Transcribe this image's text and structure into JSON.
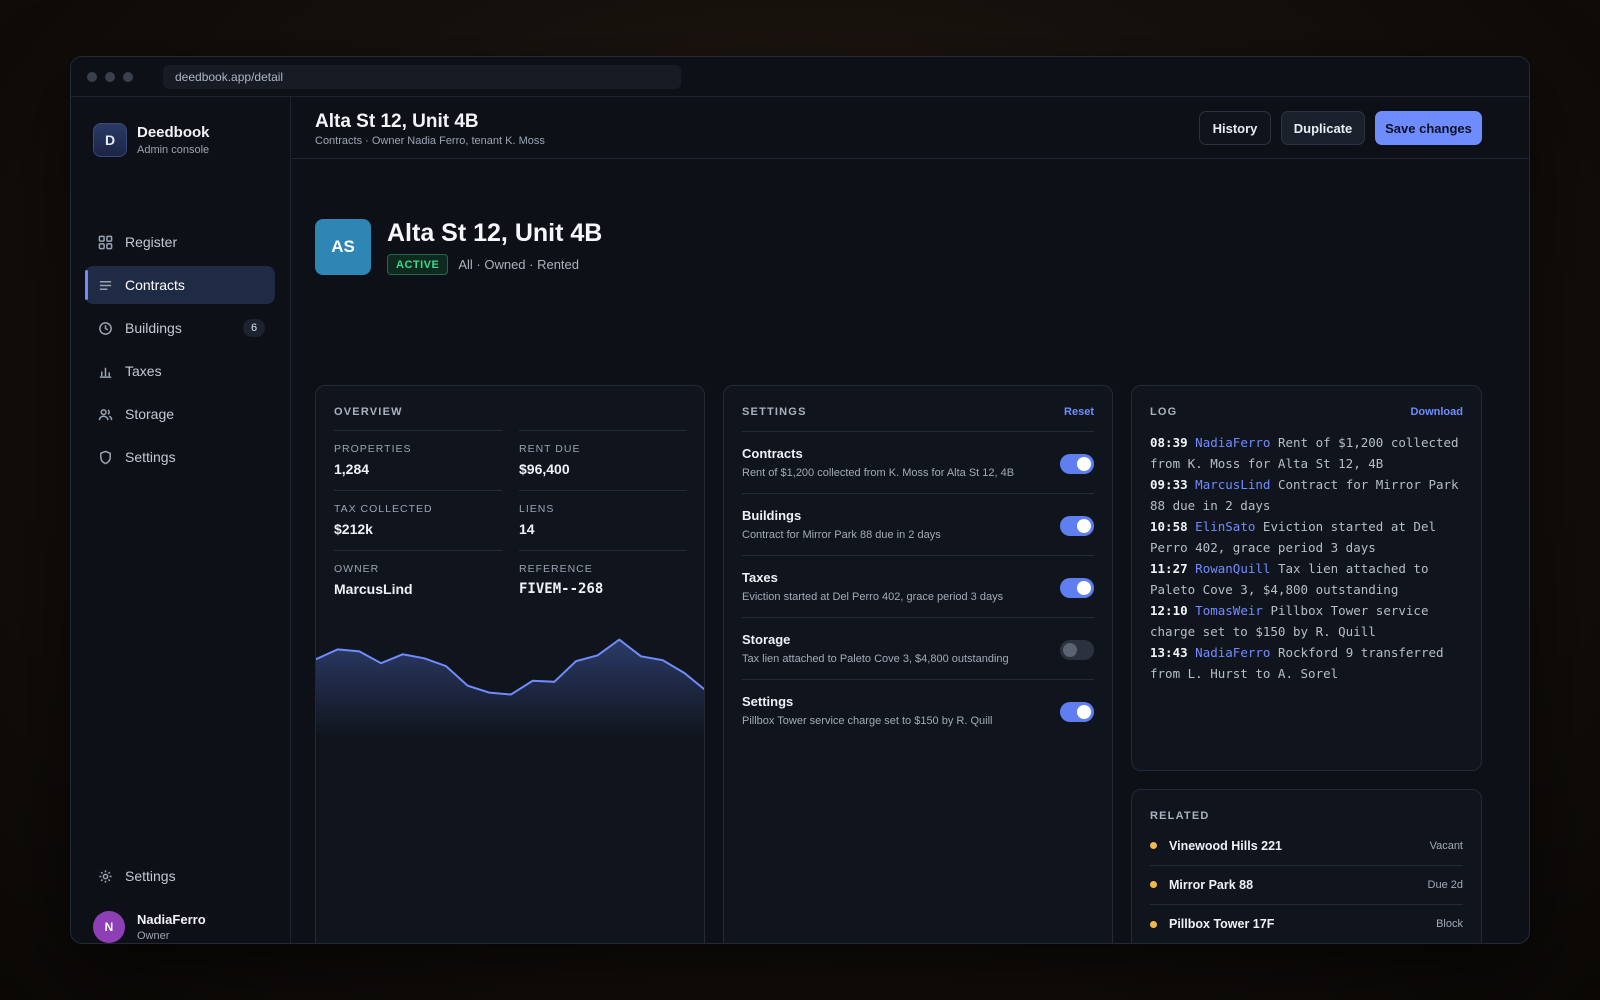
{
  "browser": {
    "url": "deedbook.app/detail"
  },
  "brand": {
    "logo_letter": "D",
    "name": "Deedbook",
    "subtitle": "Admin console"
  },
  "sidebar": {
    "items": [
      {
        "label": "Register",
        "icon": "grid-icon"
      },
      {
        "label": "Contracts",
        "icon": "list-icon",
        "active": true
      },
      {
        "label": "Buildings",
        "icon": "clock-icon",
        "badge": "6"
      },
      {
        "label": "Taxes",
        "icon": "bar-chart-icon"
      },
      {
        "label": "Storage",
        "icon": "users-icon"
      },
      {
        "label": "Settings",
        "icon": "shield-icon"
      }
    ],
    "bottom_settings": "Settings"
  },
  "user": {
    "initial": "N",
    "name": "NadiaFerro",
    "role": "Owner"
  },
  "header": {
    "title": "Alta St 12, Unit 4B",
    "subtitle": "Contracts · Owner Nadia Ferro, tenant K. Moss",
    "buttons": {
      "history": "History",
      "duplicate": "Duplicate",
      "save": "Save changes"
    }
  },
  "hero": {
    "initials": "AS",
    "title": "Alta St 12, Unit 4B",
    "status": "ACTIVE",
    "tags": "All · Owned · Rented"
  },
  "overview": {
    "label": "OVERVIEW",
    "stats": [
      {
        "key": "PROPERTIES",
        "value": "1,284"
      },
      {
        "key": "RENT DUE",
        "value": "$96,400"
      },
      {
        "key": "TAX COLLECTED",
        "value": "$212k"
      },
      {
        "key": "LIENS",
        "value": "14"
      },
      {
        "key": "OWNER",
        "value": "MarcusLind"
      },
      {
        "key": "REFERENCE",
        "value": "FIVEM--268"
      }
    ],
    "sparkline": [
      62,
      72,
      70,
      58,
      67,
      63,
      55,
      35,
      28,
      26,
      40,
      39,
      60,
      66,
      82,
      65,
      61,
      48,
      30
    ]
  },
  "settings": {
    "label": "SETTINGS",
    "action": "Reset",
    "rows": [
      {
        "title": "Contracts",
        "desc": "Rent of $1,200 collected from K. Moss for Alta St 12, 4B",
        "on": true
      },
      {
        "title": "Buildings",
        "desc": "Contract for Mirror Park 88 due in 2 days",
        "on": true
      },
      {
        "title": "Taxes",
        "desc": "Eviction started at Del Perro 402, grace period 3 days",
        "on": true
      },
      {
        "title": "Storage",
        "desc": "Tax lien attached to Paleto Cove 3, $4,800 outstanding",
        "on": false
      },
      {
        "title": "Settings",
        "desc": "Pillbox Tower service charge set to $150 by R. Quill",
        "on": true
      }
    ]
  },
  "log": {
    "label": "LOG",
    "action": "Download",
    "entries": [
      {
        "time": "08:39",
        "user": "NadiaFerro",
        "line1": "Rent of $1,200 collected",
        "line2": "from K. Moss for Alta St 12, 4B"
      },
      {
        "time": "09:33",
        "user": "MarcusLind",
        "line1": "Contract for Mirror Park",
        "line2": "88 due in 2 days"
      },
      {
        "time": "10:58",
        "user": "ElinSato",
        "line1": "Eviction started at Del",
        "line2": "Perro 402, grace period 3 days"
      },
      {
        "time": "11:27",
        "user": "RowanQuill",
        "line1": "Tax lien attached to",
        "line2": "Paleto Cove 3, $4,800 outstanding"
      },
      {
        "time": "12:10",
        "user": "TomasWeir",
        "line1": "Pillbox Tower service",
        "line2": "charge set to $150 by R. Quill"
      },
      {
        "time": "13:43",
        "user": "NadiaFerro",
        "line1": "Rockford 9 transferred",
        "line2": "from L. Hurst to A. Sorel"
      }
    ]
  },
  "related": {
    "label": "RELATED",
    "items": [
      {
        "name": "Vinewood Hills 221",
        "status": "Vacant"
      },
      {
        "name": "Mirror Park 88",
        "status": "Due 2d"
      },
      {
        "name": "Pillbox Tower 17F",
        "status": "Block"
      }
    ]
  },
  "colors": {
    "accent": "#6f8cff",
    "active_green": "#39d98a",
    "related_dot": "#f5b84a"
  }
}
